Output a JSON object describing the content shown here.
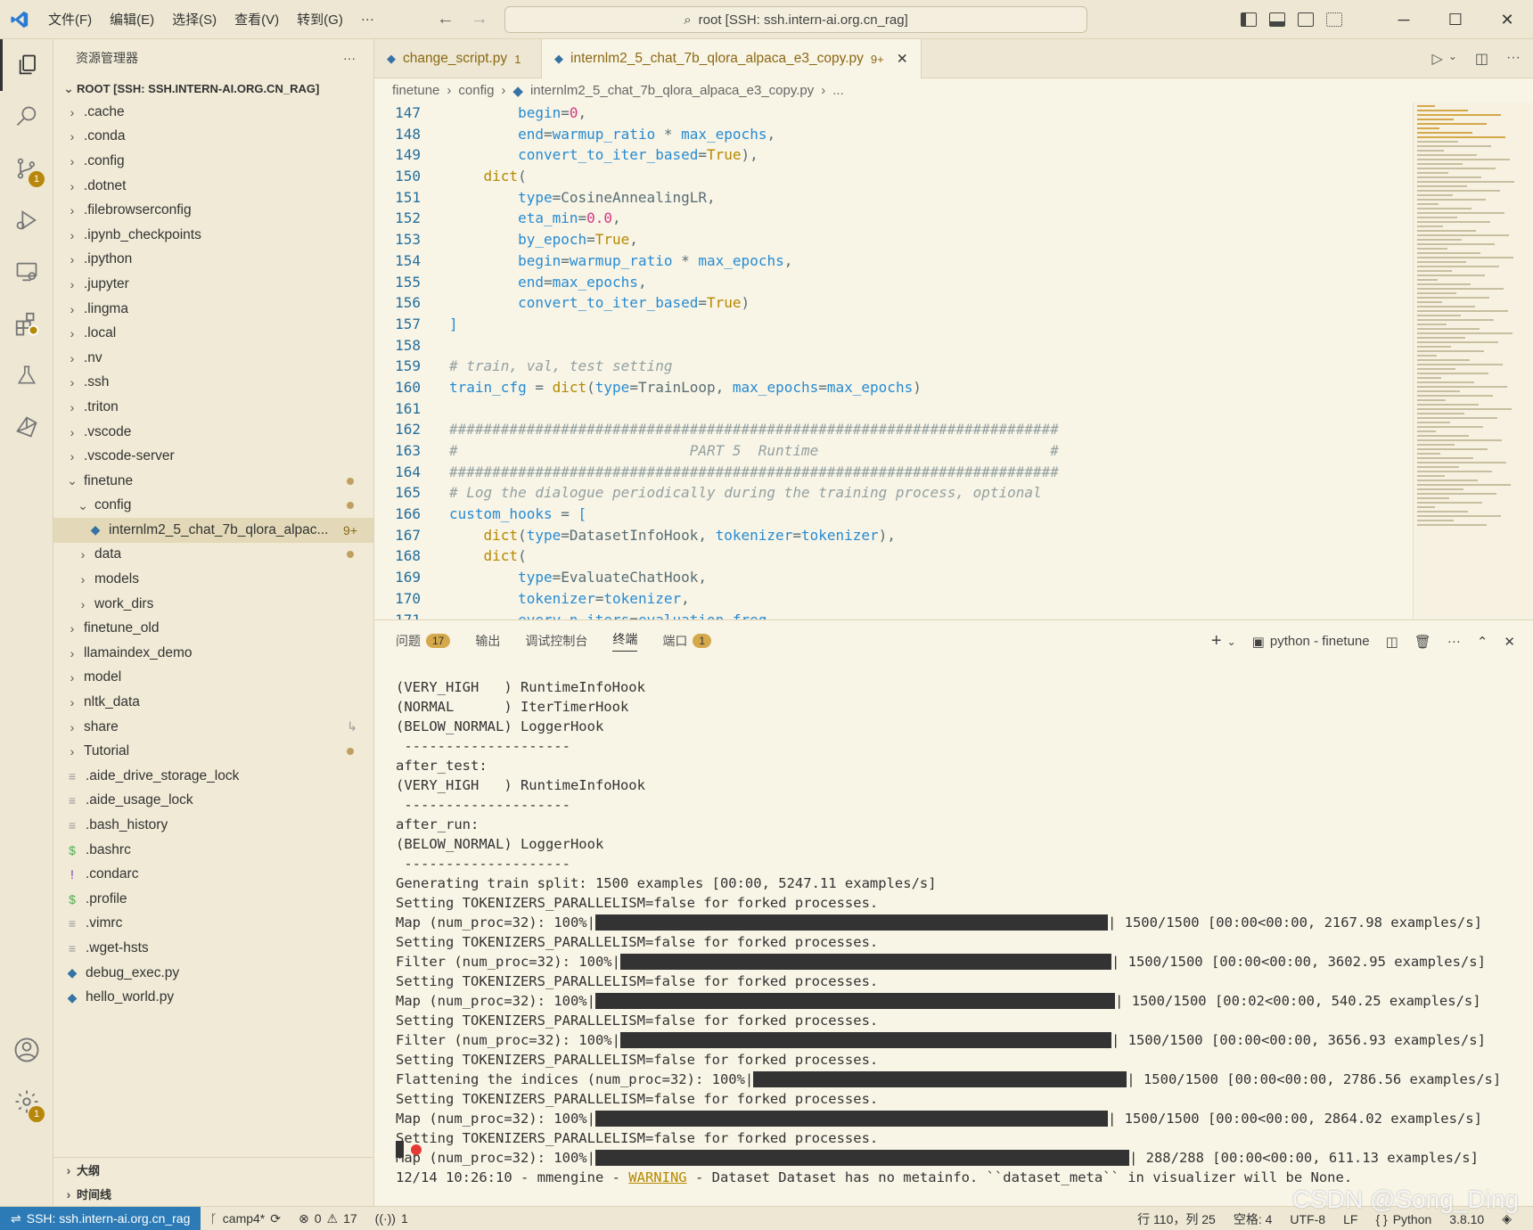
{
  "titlebar": {
    "menus": [
      "文件(F)",
      "编辑(E)",
      "选择(S)",
      "查看(V)",
      "转到(G)",
      "···"
    ],
    "command_center": "root [SSH: ssh.intern-ai.org.cn_rag]"
  },
  "activity": {
    "scm_badge": "1",
    "settings_badge": "1"
  },
  "sidebar": {
    "title": "资源管理器",
    "root": "ROOT [SSH: SSH.INTERN-AI.ORG.CN_RAG]",
    "items": [
      {
        "label": ".cache",
        "indent": 1,
        "type": "folder"
      },
      {
        "label": ".conda",
        "indent": 1,
        "type": "folder"
      },
      {
        "label": ".config",
        "indent": 1,
        "type": "folder"
      },
      {
        "label": ".dotnet",
        "indent": 1,
        "type": "folder"
      },
      {
        "label": ".filebrowserconfig",
        "indent": 1,
        "type": "folder"
      },
      {
        "label": ".ipynb_checkpoints",
        "indent": 1,
        "type": "folder"
      },
      {
        "label": ".ipython",
        "indent": 1,
        "type": "folder"
      },
      {
        "label": ".jupyter",
        "indent": 1,
        "type": "folder"
      },
      {
        "label": ".lingma",
        "indent": 1,
        "type": "folder"
      },
      {
        "label": ".local",
        "indent": 1,
        "type": "folder"
      },
      {
        "label": ".nv",
        "indent": 1,
        "type": "folder"
      },
      {
        "label": ".ssh",
        "indent": 1,
        "type": "folder"
      },
      {
        "label": ".triton",
        "indent": 1,
        "type": "folder"
      },
      {
        "label": ".vscode",
        "indent": 1,
        "type": "folder"
      },
      {
        "label": ".vscode-server",
        "indent": 1,
        "type": "folder"
      },
      {
        "label": "finetune",
        "indent": 1,
        "type": "open",
        "dot": true
      },
      {
        "label": "config",
        "indent": 2,
        "type": "open",
        "dot": true
      },
      {
        "label": "internlm2_5_chat_7b_qlora_alpac...",
        "indent": 3,
        "type": "py",
        "badge": "9+",
        "selected": true
      },
      {
        "label": "data",
        "indent": 2,
        "type": "folder",
        "dot": true
      },
      {
        "label": "models",
        "indent": 2,
        "type": "folder"
      },
      {
        "label": "work_dirs",
        "indent": 2,
        "type": "folder"
      },
      {
        "label": "finetune_old",
        "indent": 1,
        "type": "folder"
      },
      {
        "label": "llamaindex_demo",
        "indent": 1,
        "type": "folder"
      },
      {
        "label": "model",
        "indent": 1,
        "type": "folder"
      },
      {
        "label": "nltk_data",
        "indent": 1,
        "type": "folder"
      },
      {
        "label": "share",
        "indent": 1,
        "type": "folder",
        "link": true
      },
      {
        "label": "Tutorial",
        "indent": 1,
        "type": "folder",
        "dot": true
      },
      {
        "label": ".aide_drive_storage_lock",
        "indent": 1,
        "type": "file"
      },
      {
        "label": ".aide_usage_lock",
        "indent": 1,
        "type": "file"
      },
      {
        "label": ".bash_history",
        "indent": 1,
        "type": "file"
      },
      {
        "label": ".bashrc",
        "indent": 1,
        "type": "shell"
      },
      {
        "label": ".condarc",
        "indent": 1,
        "type": "bang"
      },
      {
        "label": ".profile",
        "indent": 1,
        "type": "shell"
      },
      {
        "label": ".vimrc",
        "indent": 1,
        "type": "file"
      },
      {
        "label": ".wget-hsts",
        "indent": 1,
        "type": "file"
      },
      {
        "label": "debug_exec.py",
        "indent": 1,
        "type": "py"
      },
      {
        "label": "hello_world.py",
        "indent": 1,
        "type": "py"
      }
    ],
    "outline": "大纲",
    "timeline": "时间线"
  },
  "tabs": [
    {
      "label": "change_script.py",
      "badge": "1",
      "active": false
    },
    {
      "label": "internlm2_5_chat_7b_qlora_alpaca_e3_copy.py",
      "badge": "9+",
      "active": true
    }
  ],
  "breadcrumb": [
    "finetune",
    "config",
    "internlm2_5_chat_7b_qlora_alpaca_e3_copy.py",
    "..."
  ],
  "editor": {
    "lines": [
      {
        "n": "147",
        "html": "        <span class='id'>begin</span>=<span class='num'>0</span>,"
      },
      {
        "n": "148",
        "html": "        <span class='id'>end</span>=<span class='id'>warmup_ratio</span> <span class='pl'>*</span> <span class='id'>max_epochs</span>,"
      },
      {
        "n": "149",
        "html": "        <span class='id'>convert_to_iter_based</span>=<span class='kw'>True</span>),"
      },
      {
        "n": "150",
        "html": "    <span class='fn'>dict</span>("
      },
      {
        "n": "151",
        "html": "        <span class='id'>type</span>=CosineAnnealingLR,"
      },
      {
        "n": "152",
        "html": "        <span class='id'>eta_min</span>=<span class='num'>0.0</span>,"
      },
      {
        "n": "153",
        "html": "        <span class='id'>by_epoch</span>=<span class='kw'>True</span>,"
      },
      {
        "n": "154",
        "html": "        <span class='id'>begin</span>=<span class='id'>warmup_ratio</span> <span class='pl'>*</span> <span class='id'>max_epochs</span>,"
      },
      {
        "n": "155",
        "html": "        <span class='id'>end</span>=<span class='id'>max_epochs</span>,"
      },
      {
        "n": "156",
        "html": "        <span class='id'>convert_to_iter_based</span>=<span class='kw'>True</span>)"
      },
      {
        "n": "157",
        "html": "<span class='br'>]</span>"
      },
      {
        "n": "158",
        "html": ""
      },
      {
        "n": "159",
        "html": "<span class='cm'># train, val, test setting</span>"
      },
      {
        "n": "160",
        "html": "<span class='id'>train_cfg</span> = <span class='fn'>dict</span>(<span class='id'>type</span>=TrainLoop, <span class='id'>max_epochs</span>=<span class='id'>max_epochs</span>)"
      },
      {
        "n": "161",
        "html": ""
      },
      {
        "n": "162",
        "html": "<span class='cm'>#######################################################################</span>"
      },
      {
        "n": "163",
        "html": "<span class='cm'>#                           PART 5  Runtime                           #</span>"
      },
      {
        "n": "164",
        "html": "<span class='cm'>#######################################################################</span>"
      },
      {
        "n": "165",
        "html": "<span class='cm'># Log the dialogue periodically during the training process, optional</span>"
      },
      {
        "n": "166",
        "html": "<span class='id'>custom_hooks</span> = <span class='br'>[</span>"
      },
      {
        "n": "167",
        "html": "    <span class='fn'>dict</span>(<span class='id'>type</span>=DatasetInfoHook, <span class='id'>tokenizer</span>=<span class='id'>tokenizer</span>),"
      },
      {
        "n": "168",
        "html": "    <span class='fn'>dict</span>("
      },
      {
        "n": "169",
        "html": "        <span class='id'>type</span>=EvaluateChatHook,"
      },
      {
        "n": "170",
        "html": "        <span class='id'>tokenizer</span>=<span class='id'>tokenizer</span>,"
      },
      {
        "n": "171",
        "html": "        <span class='id'>every_n_iters</span>=<span class='id'>evaluation_freq</span>,"
      }
    ]
  },
  "panel": {
    "tabs": [
      {
        "label": "问题",
        "badge": "17"
      },
      {
        "label": "输出"
      },
      {
        "label": "调试控制台"
      },
      {
        "label": "终端",
        "active": true
      },
      {
        "label": "端口",
        "badge": "1"
      }
    ],
    "terminal_name": "python - finetune",
    "terminal": [
      {
        "text": "(VERY_HIGH   ) RuntimeInfoHook"
      },
      {
        "text": "(NORMAL      ) IterTimerHook"
      },
      {
        "text": "(BELOW_NORMAL) LoggerHook"
      },
      {
        "text": " --------------------"
      },
      {
        "text": "after_test:"
      },
      {
        "text": "(VERY_HIGH   ) RuntimeInfoHook"
      },
      {
        "text": " --------------------"
      },
      {
        "text": "after_run:"
      },
      {
        "text": "(BELOW_NORMAL) LoggerHook"
      },
      {
        "text": " --------------------"
      },
      {
        "text": "Generating train split: 1500 examples [00:00, 5247.11 examples/s]"
      },
      {
        "text": "Setting TOKENIZERS_PARALLELISM=false for forked processes."
      },
      {
        "pre": "Map (num_proc=32): 100%|",
        "bar": 575,
        "post": "| 1500/1500 [00:00<00:00, 2167.98 examples/s]"
      },
      {
        "text": "Setting TOKENIZERS_PARALLELISM=false for forked processes."
      },
      {
        "pre": "Filter (num_proc=32): 100%|",
        "bar": 551,
        "post": "| 1500/1500 [00:00<00:00, 3602.95 examples/s]"
      },
      {
        "text": "Setting TOKENIZERS_PARALLELISM=false for forked processes."
      },
      {
        "pre": "Map (num_proc=32): 100%|",
        "bar": 583,
        "post": "| 1500/1500 [00:02<00:00, 540.25 examples/s]"
      },
      {
        "text": "Setting TOKENIZERS_PARALLELISM=false for forked processes."
      },
      {
        "pre": "Filter (num_proc=32): 100%|",
        "bar": 551,
        "post": "| 1500/1500 [00:00<00:00, 3656.93 examples/s]"
      },
      {
        "text": "Setting TOKENIZERS_PARALLELISM=false for forked processes."
      },
      {
        "pre": "Flattening the indices (num_proc=32): 100%|",
        "bar": 419,
        "post": "| 1500/1500 [00:00<00:00, 2786.56 examples/s]"
      },
      {
        "text": "Setting TOKENIZERS_PARALLELISM=false for forked processes."
      },
      {
        "pre": "Map (num_proc=32): 100%|",
        "bar": 575,
        "post": "| 1500/1500 [00:00<00:00, 2864.02 examples/s]"
      },
      {
        "text": "Setting TOKENIZERS_PARALLELISM=false for forked processes."
      },
      {
        "pre": "Map (num_proc=32): 100%|",
        "bar": 599,
        "post": "| 288/288 [00:00<00:00, 611.13 examples/s]"
      },
      {
        "warn": true,
        "pre": "12/14 10:26:10 - mmengine - ",
        "w": "WARNING",
        "post": " - Dataset Dataset has no metainfo. ``dataset_meta`` in visualizer will be None."
      }
    ]
  },
  "status": {
    "remote": "SSH: ssh.intern-ai.org.cn_rag",
    "branch": "camp4*",
    "errors": "0",
    "warnings": "17",
    "ports": "1",
    "position": "行 110，列 25",
    "spaces": "空格: 4",
    "encoding": "UTF-8",
    "eol": "LF",
    "language": "Python",
    "version": "3.8.10"
  },
  "watermark": "CSDN @Song_Ding",
  "colors": {
    "accent": "#b58900",
    "remote": "#2c7bb6",
    "bg": "#f8f4e6"
  }
}
